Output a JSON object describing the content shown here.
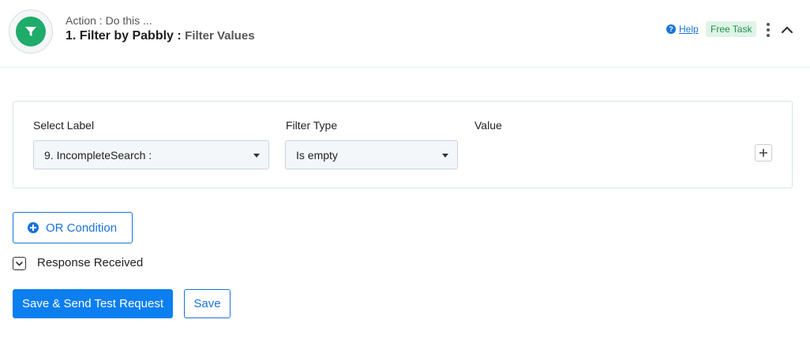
{
  "header": {
    "app_icon": "filter-icon",
    "subtitle": "Action : Do this ...",
    "step_title": "1. Filter by Pabbly : ",
    "event_name": "Filter Values",
    "help_label": "Help",
    "badge_label": "Free Task",
    "more_icon": "kebab-menu-icon",
    "collapse_icon": "chevron-up-icon"
  },
  "filter": {
    "select_label_heading": "Select Label",
    "filter_type_heading": "Filter Type",
    "value_heading": "Value",
    "select_label_value": "9. IncompleteSearch :",
    "filter_type_value": "Is empty",
    "add_icon": "plus-icon"
  },
  "or_condition": {
    "label": "OR Condition",
    "icon": "plus-circle-icon"
  },
  "response": {
    "label": "Response Received",
    "icon": "chevron-down-icon"
  },
  "actions": {
    "primary_label": "Save & Send Test Request",
    "secondary_label": "Save"
  },
  "colors": {
    "accent": "#0b7ff0",
    "brand_green": "#1fab6a",
    "badge_bg": "#dff4e7",
    "badge_text": "#1f8f4e"
  }
}
